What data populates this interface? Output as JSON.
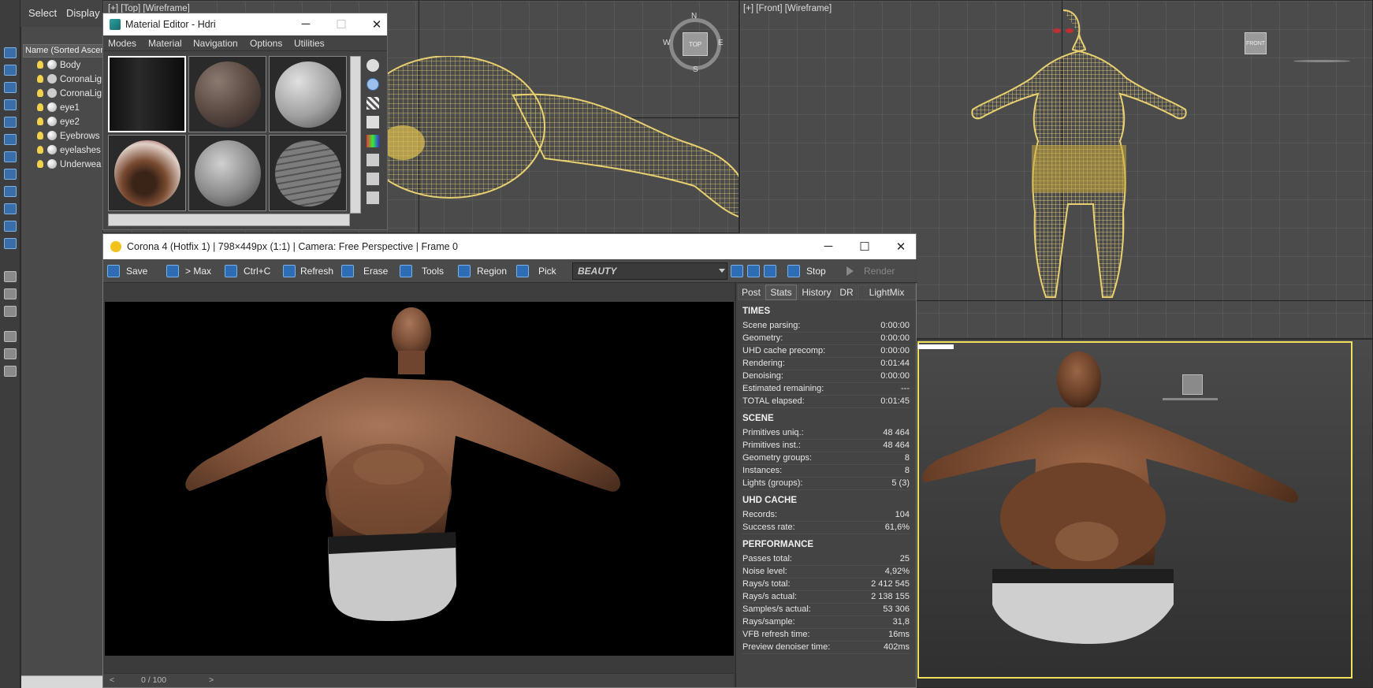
{
  "left_menu": {
    "select": "Select",
    "display": "Display"
  },
  "explorer": {
    "header": "Name (Sorted Ascen",
    "items": [
      {
        "label": "Body",
        "type": "object"
      },
      {
        "label": "CoronaLig",
        "type": "light"
      },
      {
        "label": "CoronaLig",
        "type": "light"
      },
      {
        "label": "eye1",
        "type": "object"
      },
      {
        "label": "eye2",
        "type": "object"
      },
      {
        "label": "Eyebrows",
        "type": "object"
      },
      {
        "label": "eyelashes",
        "type": "object"
      },
      {
        "label": "Underwea",
        "type": "object"
      }
    ]
  },
  "viewports": {
    "top_label": "[+] [Top] [Wireframe]",
    "front_label": "[+] [Front] [Wireframe]",
    "viewcube_top": "TOP",
    "viewcube_front": "FRONT",
    "compass": {
      "n": "N",
      "s": "S",
      "e": "E",
      "w": "W"
    }
  },
  "material_editor": {
    "title": "Material Editor - Hdri",
    "menu": [
      "Modes",
      "Material",
      "Navigation",
      "Options",
      "Utilities"
    ],
    "window_buttons": {
      "min": "─",
      "max": "☐",
      "close": "✕"
    }
  },
  "vfb": {
    "title": "Corona 4 (Hotfix 1) | 798×449px (1:1) | Camera: Free Perspective | Frame 0",
    "window_buttons": {
      "min": "─",
      "max": "☐",
      "close": "✕"
    },
    "toolbar": {
      "save": "Save",
      "to_max": "> Max",
      "copy": "Ctrl+C",
      "refresh": "Refresh",
      "erase": "Erase",
      "tools": "Tools",
      "region": "Region",
      "pick": "Pick",
      "pass": "BEAUTY",
      "stop": "Stop",
      "render": "Render"
    },
    "bottom": {
      "frame_counter": "0 / 100"
    },
    "tabs": [
      "Post",
      "Stats",
      "History",
      "DR",
      "LightMix"
    ],
    "active_tab": "Stats",
    "stats": {
      "times_title": "TIMES",
      "times": [
        {
          "k": "Scene parsing:",
          "v": "0:00:00"
        },
        {
          "k": "Geometry:",
          "v": "0:00:00"
        },
        {
          "k": "UHD cache precomp:",
          "v": "0:00:00"
        },
        {
          "k": "Rendering:",
          "v": "0:01:44"
        },
        {
          "k": "Denoising:",
          "v": "0:00:00"
        },
        {
          "k": "Estimated remaining:",
          "v": "---"
        },
        {
          "k": "TOTAL elapsed:",
          "v": "0:01:45"
        }
      ],
      "scene_title": "SCENE",
      "scene": [
        {
          "k": "Primitives uniq.:",
          "v": "48 464"
        },
        {
          "k": "Primitives inst.:",
          "v": "48 464"
        },
        {
          "k": "Geometry groups:",
          "v": "8"
        },
        {
          "k": "Instances:",
          "v": "8"
        },
        {
          "k": "Lights (groups):",
          "v": "5 (3)"
        }
      ],
      "uhd_title": "UHD CACHE",
      "uhd": [
        {
          "k": "Records:",
          "v": "104"
        },
        {
          "k": "Success rate:",
          "v": "61,6%"
        }
      ],
      "perf_title": "PERFORMANCE",
      "perf": [
        {
          "k": "Passes total:",
          "v": "25"
        },
        {
          "k": "Noise level:",
          "v": "4,92%"
        },
        {
          "k": "Rays/s total:",
          "v": "2 412 545"
        },
        {
          "k": "Rays/s actual:",
          "v": "2 138 155"
        },
        {
          "k": "Samples/s actual:",
          "v": "53 306"
        },
        {
          "k": "Rays/sample:",
          "v": "31,8"
        },
        {
          "k": "VFB refresh time:",
          "v": "16ms"
        },
        {
          "k": "Preview denoiser time:",
          "v": "402ms"
        }
      ]
    }
  },
  "colors": {
    "wire": "#e8d070",
    "accent": "#2e6db4",
    "selection": "#f0e060"
  }
}
